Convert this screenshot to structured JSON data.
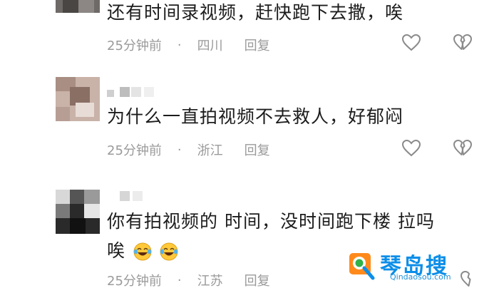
{
  "comments": [
    {
      "text": "还有时间录视频，赶快跑下去撒，唉",
      "time": "25分钟前",
      "separator": "·",
      "location": "四川",
      "reply_label": "回复"
    },
    {
      "text": "为什么一直拍视频不去救人，好郁闷",
      "time": "25分钟前",
      "separator": "·",
      "location": "浙江",
      "reply_label": "回复"
    },
    {
      "text_line1": "你有拍视频的 时间，没时间跑下楼 拉吗",
      "text_line2": "唉",
      "time": "25分钟前",
      "separator": "·",
      "location": "江苏",
      "reply_label": "回复"
    }
  ],
  "icons": {
    "like": "heart-outline-icon",
    "dislike": "broken-heart-icon",
    "emoji": "laughing-crying-emoji"
  },
  "watermark": {
    "title": "琴岛搜",
    "url": "Qindaosou.com"
  },
  "colors": {
    "text": "#1c1c1c",
    "meta": "#9a9a9a",
    "icon": "#8a8a8a",
    "watermark": "#0c8ee8"
  }
}
